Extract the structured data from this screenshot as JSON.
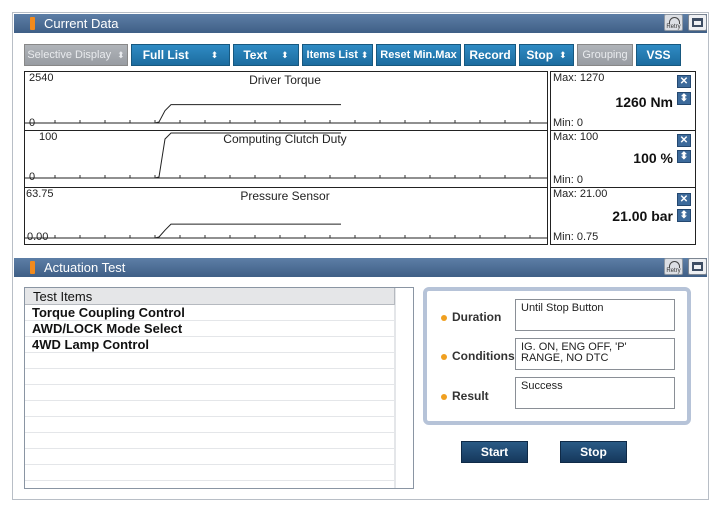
{
  "current_data": {
    "title": "Current Data",
    "retry_label": "Retry",
    "toolbar": {
      "selective_display": "Selective Display",
      "full_list": "Full List",
      "text": "Text",
      "items_list": "Items List",
      "reset_min_max": "Reset Min.Max",
      "record": "Record",
      "stop": "Stop",
      "grouping": "Grouping",
      "vss": "VSS"
    },
    "graphs": [
      {
        "title": "Driver Torque",
        "axis_max": "2540",
        "axis_min": "0",
        "max_label": "Max: 1270",
        "min_label": "Min:  0",
        "value": "1260 Nm",
        "level": 0.496
      },
      {
        "title": "Computing Clutch Duty",
        "axis_max": "100",
        "axis_min": "0",
        "max_label": "Max: 100",
        "min_label": "Min:  0",
        "value": "100 %",
        "level": 1.0
      },
      {
        "title": "Pressure Sensor",
        "axis_max": "63.75",
        "axis_min": "0.00",
        "max_label": "Max: 21.00",
        "min_label": "Min:  0.75",
        "value": "21.00 bar",
        "level": 0.329
      }
    ]
  },
  "actuation_test": {
    "title": "Actuation Test",
    "retry_label": "Retry",
    "list_header": "Test Items",
    "items": [
      "Torque Coupling Control",
      "AWD/LOCK Mode Select",
      "4WD Lamp Control"
    ],
    "duration_label": "Duration",
    "duration_value": "Until Stop Button",
    "conditions_label": "Conditions",
    "conditions_value": "IG. ON, ENG OFF, 'P' RANGE, NO DTC",
    "result_label": "Result",
    "result_value": "Success",
    "start_label": "Start",
    "stop_label": "Stop"
  }
}
